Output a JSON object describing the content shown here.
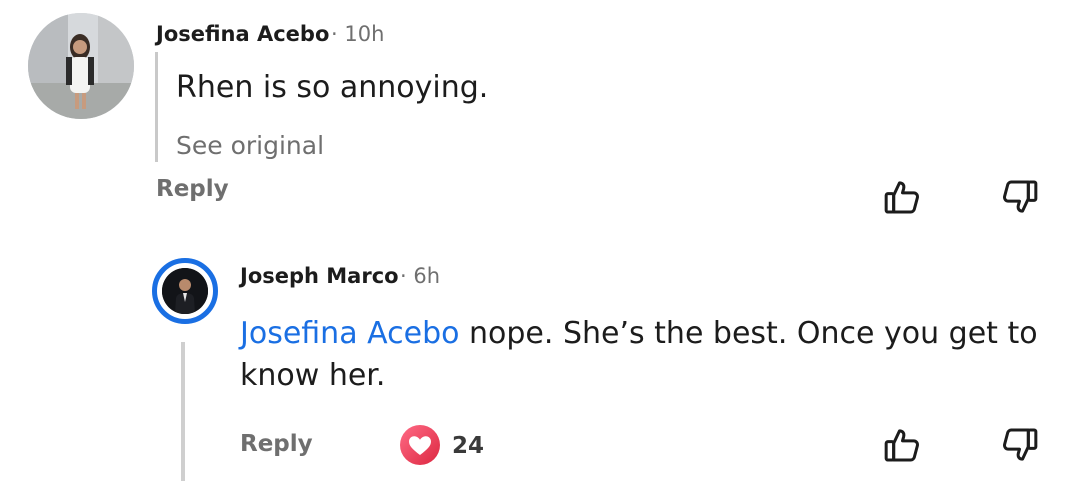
{
  "comment": {
    "author": "Josefina Acebo",
    "time": "· 10h",
    "text": "Rhen is so annoying.",
    "see_original": "See original",
    "reply_label": "Reply"
  },
  "reply": {
    "author": "Joseph Marco",
    "time": "· 6h",
    "mention": "Josefina Acebo",
    "text": " nope. She’s the best. Once you get to know her.",
    "reply_label": "Reply",
    "reaction_count": "24"
  },
  "icons": {
    "like": "thumbs-up-icon",
    "dislike": "thumbs-down-icon",
    "reaction": "heart-icon"
  },
  "colors": {
    "mention": "#1a6fe3",
    "avatar_ring": "#1a6fe3",
    "heart_start": "#ff5f7e",
    "heart_end": "#e0243f"
  }
}
